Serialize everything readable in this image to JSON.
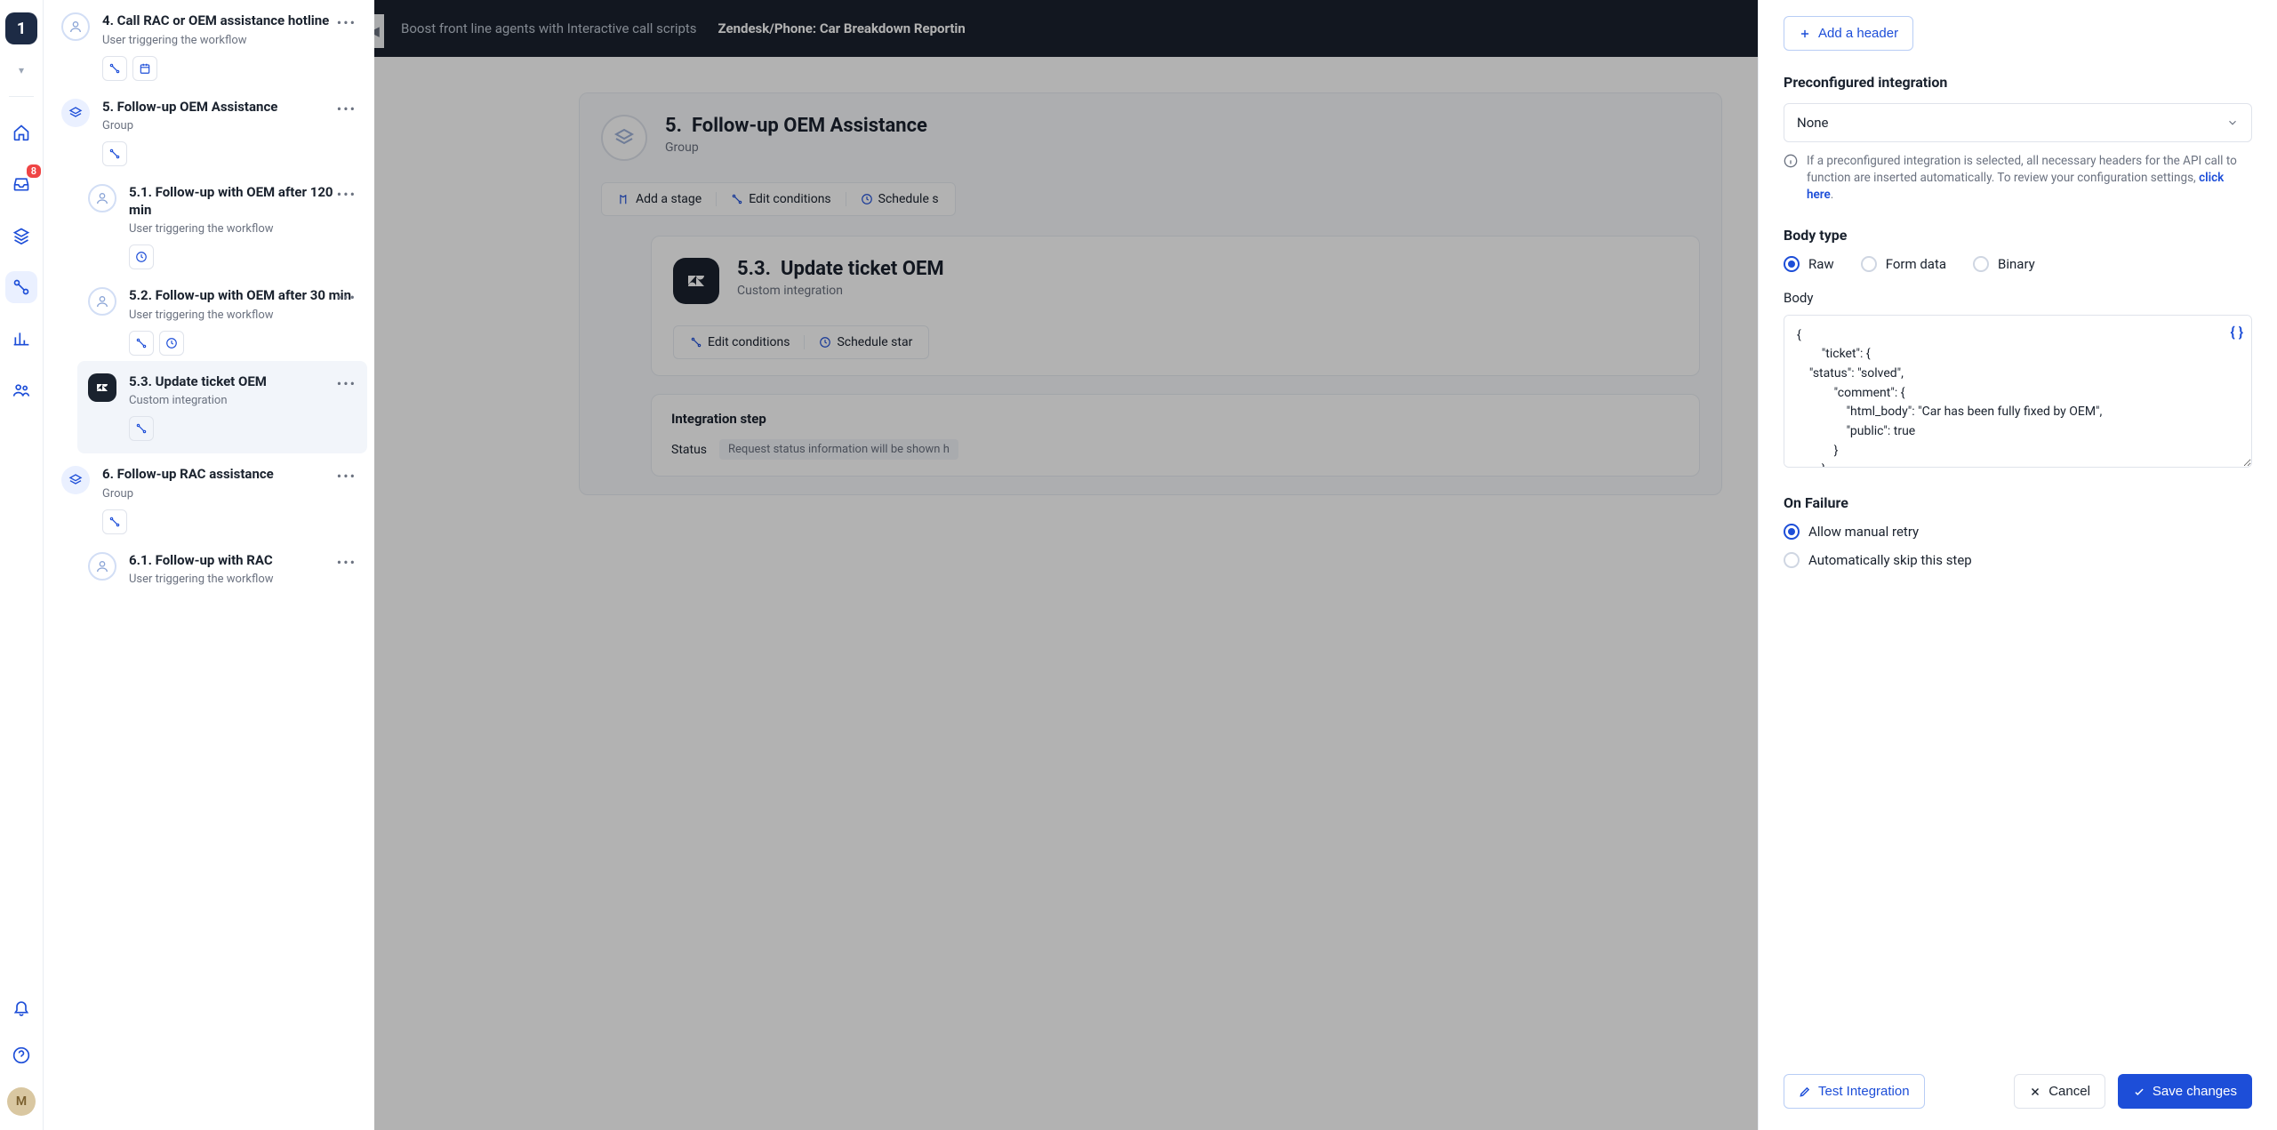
{
  "rail": {
    "logo": "1",
    "inbox_badge": "8",
    "avatar_initial": "M"
  },
  "sidebar": {
    "step4": {
      "title": "4. Call RAC or OEM assistance hotline",
      "sub": "User triggering the workflow"
    },
    "step5": {
      "title": "5. Follow-up OEM Assistance",
      "sub": "Group"
    },
    "step5_1": {
      "title": "5.1. Follow-up with OEM after 120 min",
      "sub": "User triggering the workflow"
    },
    "step5_2": {
      "title": "5.2. Follow-up with OEM after 30 min",
      "sub": "User triggering the workflow"
    },
    "step5_3": {
      "title": "5.3. Update ticket OEM",
      "sub": "Custom integration"
    },
    "step6": {
      "title": "6. Follow-up RAC assistance",
      "sub": "Group"
    },
    "step6_1": {
      "title": "6.1. Follow-up with RAC",
      "sub": "User triggering the workflow"
    }
  },
  "crumbs": {
    "static": "Boost front line agents with Interactive call scripts",
    "strong": "Zendesk/Phone: Car Breakdown Reportin"
  },
  "canvas": {
    "card5": {
      "num": "5.",
      "title": "Follow-up OEM Assistance",
      "sub": "Group",
      "add_stage": "Add a stage",
      "edit_conditions": "Edit conditions",
      "schedule": "Schedule s"
    },
    "card53": {
      "num": "5.3.",
      "title": "Update ticket OEM",
      "sub": "Custom integration",
      "edit_conditions": "Edit conditions",
      "schedule": "Schedule star"
    },
    "integration_box": {
      "title": "Integration step",
      "status_label": "Status",
      "status_value": "Request status information will be shown h"
    }
  },
  "panel": {
    "add_header": "Add a header",
    "preconfig_label": "Preconfigured integration",
    "preconfig_value": "None",
    "preconfig_info": "If a preconfigured integration is selected, all necessary headers for the API call to function are inserted automatically. To review your configuration settings, ",
    "preconfig_link": "click here",
    "body_type_label": "Body type",
    "body_types": {
      "raw": "Raw",
      "form": "Form data",
      "binary": "Binary"
    },
    "body_label": "Body",
    "body_value": "{\n        \"ticket\": {\n    \"status\": \"solved\",\n            \"comment\": {\n                \"html_body\": \"Car has been fully fixed by OEM\",\n                \"public\": true\n            }\n        }\n}",
    "on_failure_label": "On Failure",
    "on_failure": {
      "retry": "Allow manual retry",
      "skip": "Automatically skip this step"
    },
    "test": "Test Integration",
    "cancel": "Cancel",
    "save": "Save changes"
  }
}
